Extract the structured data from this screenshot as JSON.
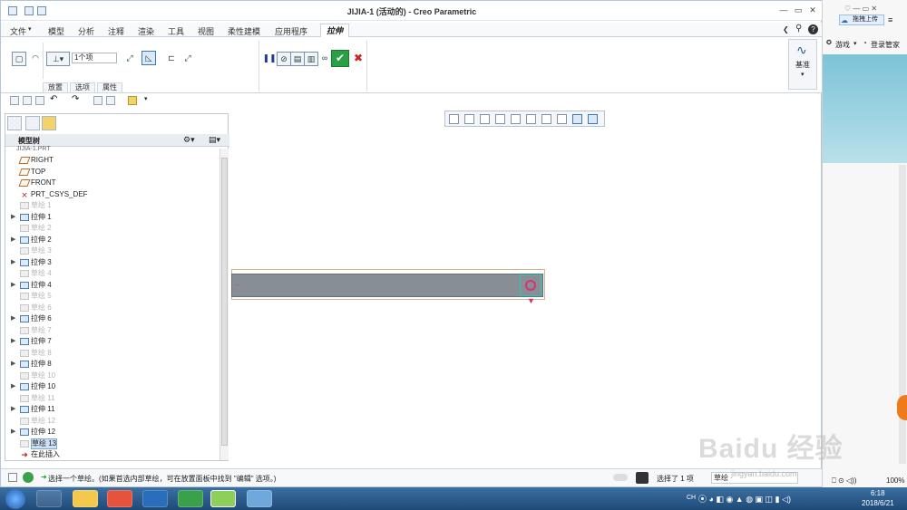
{
  "app": {
    "title": "JIJIA-1 (活动的) - Creo Parametric"
  },
  "menu": {
    "items": [
      "文件",
      "模型",
      "分析",
      "注释",
      "渲染",
      "工具",
      "视图",
      "柔性建模",
      "应用程序"
    ],
    "active": "拉伸"
  },
  "ribbon": {
    "depth_value": "1个项",
    "tabs": [
      "放置",
      "选项",
      "属性"
    ],
    "datum_label": "基准"
  },
  "tree": {
    "header": "模型树",
    "root": "JIJIA-1.PRT",
    "items": [
      {
        "label": "RIGHT",
        "type": "plane",
        "muted": false,
        "expand": ""
      },
      {
        "label": "TOP",
        "type": "plane",
        "muted": false,
        "expand": ""
      },
      {
        "label": "FRONT",
        "type": "plane",
        "muted": false,
        "expand": ""
      },
      {
        "label": "PRT_CSYS_DEF",
        "type": "csys",
        "muted": false,
        "expand": ""
      },
      {
        "label": "草绘 1",
        "type": "sketch",
        "muted": true,
        "expand": ""
      },
      {
        "label": "拉伸 1",
        "type": "extrude",
        "muted": false,
        "expand": "▶"
      },
      {
        "label": "草绘 2",
        "type": "sketch",
        "muted": true,
        "expand": ""
      },
      {
        "label": "拉伸 2",
        "type": "extrude",
        "muted": false,
        "expand": "▶"
      },
      {
        "label": "草绘 3",
        "type": "sketch",
        "muted": true,
        "expand": ""
      },
      {
        "label": "拉伸 3",
        "type": "extrude",
        "muted": false,
        "expand": "▶"
      },
      {
        "label": "草绘 4",
        "type": "sketch",
        "muted": true,
        "expand": ""
      },
      {
        "label": "拉伸 4",
        "type": "extrude",
        "muted": false,
        "expand": "▶"
      },
      {
        "label": "草绘 5",
        "type": "sketch",
        "muted": true,
        "expand": ""
      },
      {
        "label": "草绘 6",
        "type": "sketch",
        "muted": true,
        "expand": ""
      },
      {
        "label": "拉伸 6",
        "type": "extrude",
        "muted": false,
        "expand": "▶"
      },
      {
        "label": "草绘 7",
        "type": "sketch",
        "muted": true,
        "expand": ""
      },
      {
        "label": "拉伸 7",
        "type": "extrude",
        "muted": false,
        "expand": "▶"
      },
      {
        "label": "草绘 8",
        "type": "sketch",
        "muted": true,
        "expand": ""
      },
      {
        "label": "拉伸 8",
        "type": "extrude",
        "muted": false,
        "expand": "▶"
      },
      {
        "label": "草绘 10",
        "type": "sketch",
        "muted": true,
        "expand": ""
      },
      {
        "label": "拉伸 10",
        "type": "extrude",
        "muted": false,
        "expand": "▶"
      },
      {
        "label": "草绘 11",
        "type": "sketch",
        "muted": true,
        "expand": ""
      },
      {
        "label": "拉伸 11",
        "type": "extrude",
        "muted": false,
        "expand": "▶"
      },
      {
        "label": "草绘 12",
        "type": "sketch",
        "muted": true,
        "expand": ""
      },
      {
        "label": "拉伸 12",
        "type": "extrude",
        "muted": false,
        "expand": "▶"
      },
      {
        "label": "草绘 13",
        "type": "sketch",
        "muted": false,
        "expand": ""
      },
      {
        "label": "在此插入",
        "type": "insert",
        "muted": false,
        "expand": ""
      }
    ]
  },
  "status": {
    "message": "选择一个草绘。(如果首选内部草绘，可在放置面板中找到 \"编辑\" 选项。)",
    "selected": "选择了 1 项",
    "filter": "草绘"
  },
  "sidebar": {
    "upload": "拖拽上传",
    "game": "游戏",
    "login": "登录管家",
    "zoom": "100%"
  },
  "taskbar": {
    "time": "6:18",
    "date": "2018/6/21",
    "lang": "CH"
  },
  "watermark": {
    "text": "Baidu 经验",
    "url": "jingyan.baidu.com"
  },
  "colors": {
    "accent": "#2a6ebb",
    "part_face": "#888e96",
    "confirm": "#1f9d35",
    "cancel": "#cc2222"
  }
}
